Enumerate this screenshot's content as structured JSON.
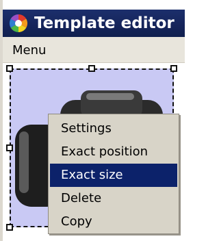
{
  "window": {
    "title": "Template editor"
  },
  "menubar": {
    "menu_label": "Menu"
  },
  "context_menu": {
    "items": [
      {
        "label": "Settings"
      },
      {
        "label": "Exact position"
      },
      {
        "label": "Exact size",
        "selected": true
      },
      {
        "label": "Delete"
      },
      {
        "label": "Copy"
      }
    ]
  },
  "colors": {
    "titlebar": "#15245a",
    "menu_selection": "#0c226a",
    "template_background": "#c9c9f4"
  },
  "icons": {
    "app": "color-wheel-icon"
  }
}
